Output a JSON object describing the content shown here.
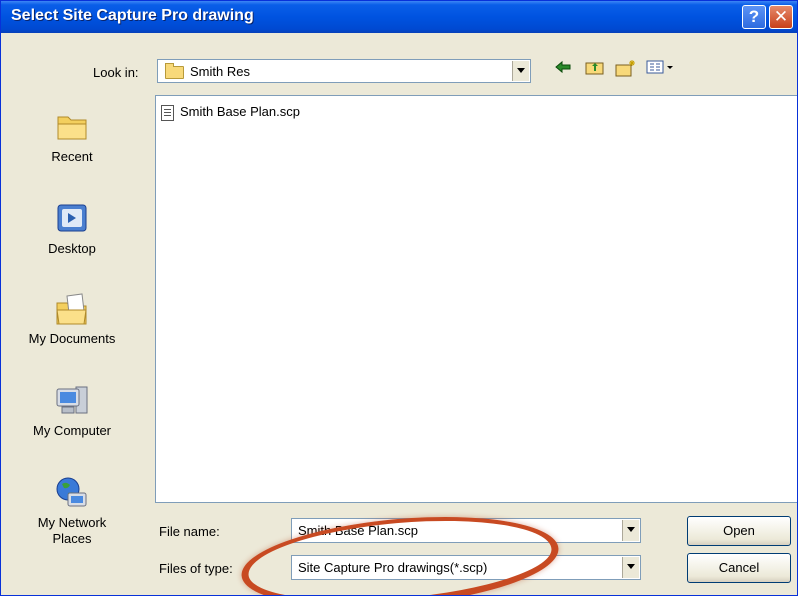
{
  "window": {
    "title": "Select Site Capture Pro drawing"
  },
  "titlebar": {
    "help_glyph": "?",
    "close_glyph": "✕"
  },
  "toolbar": {
    "look_in_label": "Look in:",
    "look_in_value": "Smith Res",
    "icons": [
      "back-icon",
      "up-folder-icon",
      "new-folder-icon",
      "view-menu-icon"
    ]
  },
  "places": [
    {
      "label": "Recent",
      "icon": "recent-folder-icon"
    },
    {
      "label": "Desktop",
      "icon": "desktop-icon"
    },
    {
      "label": "My Documents",
      "icon": "my-documents-icon"
    },
    {
      "label": "My Computer",
      "icon": "my-computer-icon"
    },
    {
      "label": "My Network\nPlaces",
      "icon": "network-places-icon"
    }
  ],
  "files": [
    {
      "name": "Smith Base Plan.scp",
      "icon": "document-icon"
    }
  ],
  "form": {
    "file_name_label": "File name:",
    "file_name_value": "Smith Base Plan.scp",
    "file_type_label": "Files of type:",
    "file_type_value": "Site Capture Pro drawings(*.scp)"
  },
  "buttons": {
    "open": "Open",
    "cancel": "Cancel"
  },
  "colors": {
    "titlebar": "#0053e0",
    "dialog_bg": "#ece9d8",
    "highlight": "#c84a22"
  }
}
